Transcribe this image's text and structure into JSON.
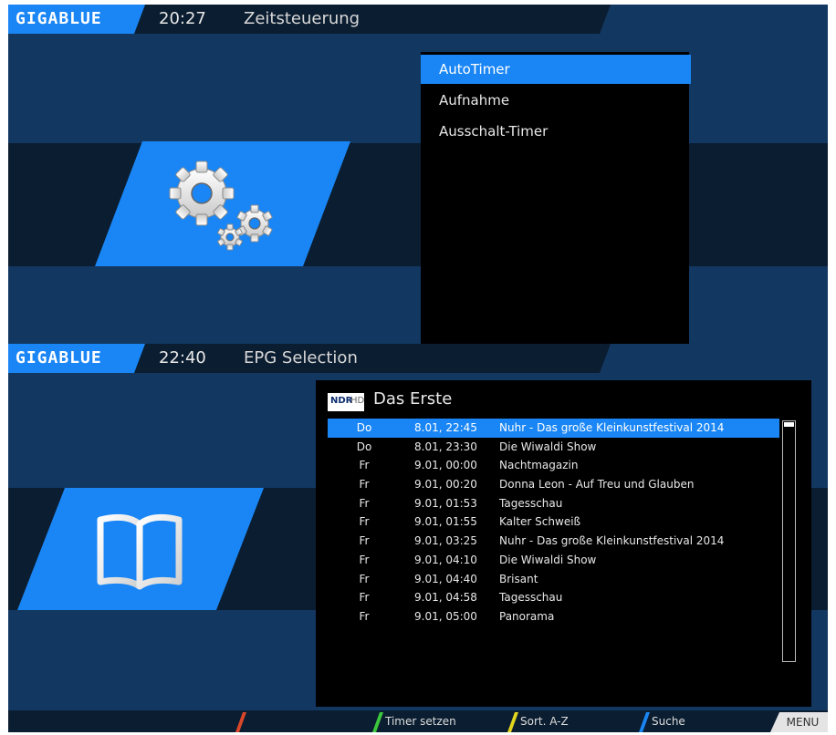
{
  "colors": {
    "accent": "#1a86f5",
    "bg": "#123760",
    "dark": "#0b1d30",
    "red": "#d9472b",
    "green": "#3cc83c",
    "yellow": "#e2d51d",
    "blue": "#1a86f5"
  },
  "screen1": {
    "logo": "GIGABLUE",
    "clock": "20:27",
    "title": "Zeitsteuerung",
    "icon": "gears-icon",
    "menu": [
      {
        "label": "AutoTimer",
        "selected": true
      },
      {
        "label": "Aufnahme",
        "selected": false
      },
      {
        "label": "Ausschalt-Timer",
        "selected": false
      }
    ]
  },
  "screen2": {
    "logo": "GIGABLUE",
    "clock": "22:40",
    "title": "EPG Selection",
    "icon": "book-icon",
    "channel_logo": {
      "ndr": "NDR",
      "hd": "HD"
    },
    "channel_name": "Das Erste",
    "events": [
      {
        "day": "Do",
        "time": "8.01, 22:45",
        "title": "Nuhr - Das große Kleinkunstfestival 2014"
      },
      {
        "day": "Do",
        "time": "8.01, 23:30",
        "title": "Die Wiwaldi Show"
      },
      {
        "day": "Fr",
        "time": "9.01, 00:00",
        "title": "Nachtmagazin"
      },
      {
        "day": "Fr",
        "time": "9.01, 00:20",
        "title": "Donna Leon - Auf Treu und Glauben"
      },
      {
        "day": "Fr",
        "time": "9.01, 01:53",
        "title": "Tagesschau"
      },
      {
        "day": "Fr",
        "time": "9.01, 01:55",
        "title": "Kalter Schweiß"
      },
      {
        "day": "Fr",
        "time": "9.01, 03:25",
        "title": "Nuhr - Das große Kleinkunstfestival 2014"
      },
      {
        "day": "Fr",
        "time": "9.01, 04:10",
        "title": "Die Wiwaldi Show"
      },
      {
        "day": "Fr",
        "time": "9.01, 04:40",
        "title": "Brisant"
      },
      {
        "day": "Fr",
        "time": "9.01, 04:58",
        "title": "Tagesschau"
      },
      {
        "day": "Fr",
        "time": "9.01, 05:00",
        "title": "Panorama"
      }
    ],
    "footer": {
      "green": "Timer setzen",
      "yellow": "Sort. A-Z",
      "blue": "Suche",
      "menu": "MENU"
    }
  }
}
